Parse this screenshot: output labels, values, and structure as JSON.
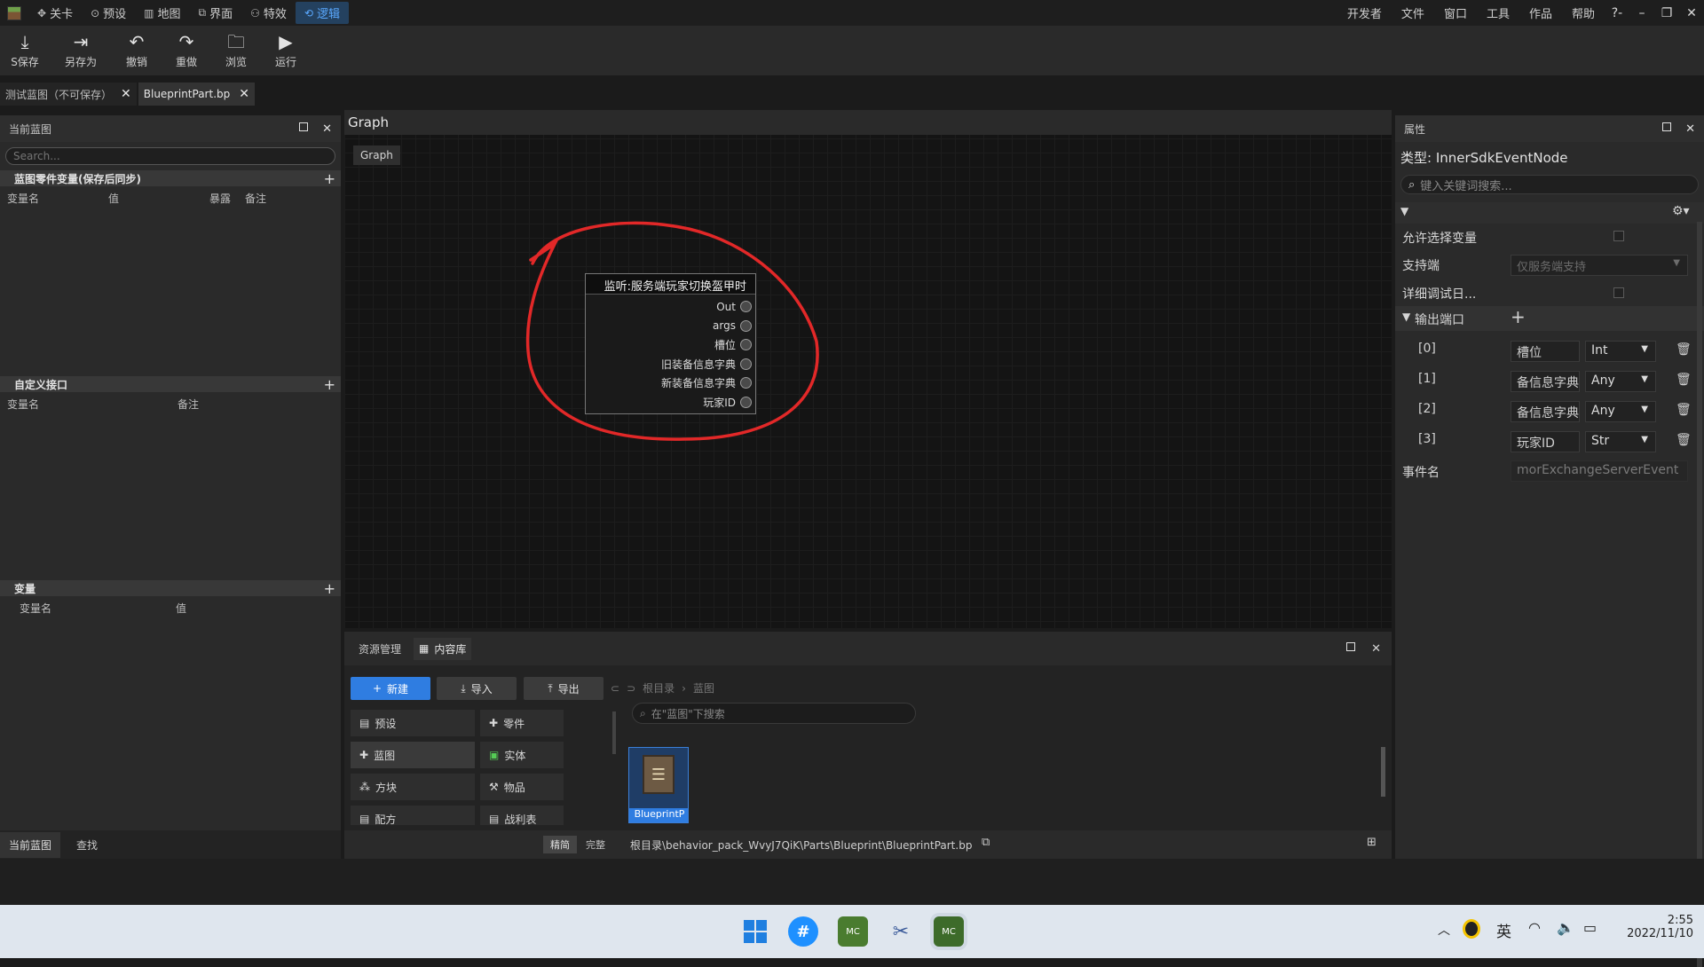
{
  "menubar": {
    "items": [
      {
        "label": "关卡",
        "icon": "level-icon"
      },
      {
        "label": "预设",
        "icon": "preset-icon"
      },
      {
        "label": "地图",
        "icon": "map-icon"
      },
      {
        "label": "界面",
        "icon": "ui-icon"
      },
      {
        "label": "特效",
        "icon": "effects-icon"
      },
      {
        "label": "逻辑",
        "icon": "logic-icon"
      }
    ],
    "right": [
      "开发者",
      "文件",
      "窗口",
      "工具",
      "作品",
      "帮助"
    ],
    "help_glyph": "?-",
    "accent": "#5aa9ff"
  },
  "toolbar": {
    "save": "S保存",
    "save_as": "另存为",
    "undo": "撤销",
    "redo": "重做",
    "browse": "浏览",
    "run": "运行"
  },
  "doc_tabs": [
    {
      "label": "测试蓝图（不可保存）"
    },
    {
      "label": "BlueprintPart.bp"
    }
  ],
  "left": {
    "title": "当前蓝图",
    "search_placeholder": "Search...",
    "sec1": {
      "title": "蓝图零件变量(保存后同步)",
      "cols": [
        "变量名",
        "值",
        "暴露",
        "备注"
      ]
    },
    "sec2": {
      "title": "自定义接口",
      "cols": [
        "变量名",
        "备注"
      ]
    },
    "sec3": {
      "title": "变量",
      "cols": [
        "变量名",
        "值"
      ]
    },
    "bottom_tabs": [
      "当前蓝图",
      "查找"
    ]
  },
  "graph": {
    "title": "Graph",
    "breadcrumb": "Graph",
    "node": {
      "title": "监听:服务端玩家切换盔甲时",
      "ports": [
        "Out",
        "args",
        "槽位",
        "旧装备信息字典",
        "新装备信息字典",
        "玩家ID"
      ]
    }
  },
  "content": {
    "tabs": [
      "资源管理",
      "内容库"
    ],
    "new_btn": "新建",
    "import_btn": "导入",
    "export_btn": "导出",
    "path_root": "根目录",
    "path_leaf": "蓝图",
    "search_placeholder": "在\"蓝图\"下搜索",
    "categories": [
      "预设",
      "零件",
      "蓝图",
      "实体",
      "方块",
      "物品",
      "配方",
      "战利表"
    ],
    "mode_buttons": [
      "精简",
      "完整"
    ],
    "asset_label": "BlueprintP",
    "file_path": "根目录\\behavior_pack_WvyJ7QiK\\Parts\\Blueprint\\BlueprintPart.bp"
  },
  "props": {
    "title": "属性",
    "type_label": "类型: InnerSdkEventNode",
    "search_placeholder": "键入关键词搜索...",
    "allow_select_var": "允许选择变量",
    "support_side": "支持端",
    "support_side_value": "仅服务端支持",
    "detailed_debug": "详细调试日...",
    "output_ports": "输出端口",
    "ports": [
      {
        "index": "[0]",
        "name": "槽位",
        "type": "Int"
      },
      {
        "index": "[1]",
        "name": "备信息字典",
        "type": "Any"
      },
      {
        "index": "[2]",
        "name": "备信息字典",
        "type": "Any"
      },
      {
        "index": "[3]",
        "name": "玩家ID",
        "type": "Str"
      }
    ],
    "event_name_label": "事件名",
    "event_name_value": "morExchangeServerEvent"
  },
  "taskbar": {
    "ime": "英",
    "time": "2:55",
    "date": "2022/11/10"
  }
}
